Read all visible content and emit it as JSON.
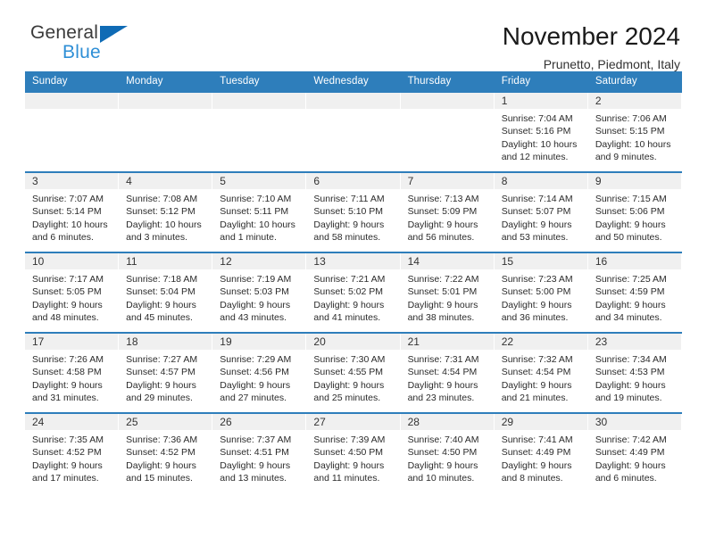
{
  "brand": {
    "line1": "General",
    "line2": "Blue",
    "triangle_color": "#0f6bb5",
    "blue_text_color": "#2f8fd6"
  },
  "header": {
    "title": "November 2024",
    "subtitle": "Prunetto, Piedmont, Italy",
    "accent_color": "#2e7ebb",
    "daynum_strip_color": "#f0f0f0"
  },
  "weekdays": [
    "Sunday",
    "Monday",
    "Tuesday",
    "Wednesday",
    "Thursday",
    "Friday",
    "Saturday"
  ],
  "weeks": [
    [
      {
        "day": "",
        "empty": true
      },
      {
        "day": "",
        "empty": true
      },
      {
        "day": "",
        "empty": true
      },
      {
        "day": "",
        "empty": true
      },
      {
        "day": "",
        "empty": true
      },
      {
        "day": "1",
        "sunrise": "Sunrise: 7:04 AM",
        "sunset": "Sunset: 5:16 PM",
        "daylight1": "Daylight: 10 hours",
        "daylight2": "and 12 minutes."
      },
      {
        "day": "2",
        "sunrise": "Sunrise: 7:06 AM",
        "sunset": "Sunset: 5:15 PM",
        "daylight1": "Daylight: 10 hours",
        "daylight2": "and 9 minutes."
      }
    ],
    [
      {
        "day": "3",
        "sunrise": "Sunrise: 7:07 AM",
        "sunset": "Sunset: 5:14 PM",
        "daylight1": "Daylight: 10 hours",
        "daylight2": "and 6 minutes."
      },
      {
        "day": "4",
        "sunrise": "Sunrise: 7:08 AM",
        "sunset": "Sunset: 5:12 PM",
        "daylight1": "Daylight: 10 hours",
        "daylight2": "and 3 minutes."
      },
      {
        "day": "5",
        "sunrise": "Sunrise: 7:10 AM",
        "sunset": "Sunset: 5:11 PM",
        "daylight1": "Daylight: 10 hours",
        "daylight2": "and 1 minute."
      },
      {
        "day": "6",
        "sunrise": "Sunrise: 7:11 AM",
        "sunset": "Sunset: 5:10 PM",
        "daylight1": "Daylight: 9 hours",
        "daylight2": "and 58 minutes."
      },
      {
        "day": "7",
        "sunrise": "Sunrise: 7:13 AM",
        "sunset": "Sunset: 5:09 PM",
        "daylight1": "Daylight: 9 hours",
        "daylight2": "and 56 minutes."
      },
      {
        "day": "8",
        "sunrise": "Sunrise: 7:14 AM",
        "sunset": "Sunset: 5:07 PM",
        "daylight1": "Daylight: 9 hours",
        "daylight2": "and 53 minutes."
      },
      {
        "day": "9",
        "sunrise": "Sunrise: 7:15 AM",
        "sunset": "Sunset: 5:06 PM",
        "daylight1": "Daylight: 9 hours",
        "daylight2": "and 50 minutes."
      }
    ],
    [
      {
        "day": "10",
        "sunrise": "Sunrise: 7:17 AM",
        "sunset": "Sunset: 5:05 PM",
        "daylight1": "Daylight: 9 hours",
        "daylight2": "and 48 minutes."
      },
      {
        "day": "11",
        "sunrise": "Sunrise: 7:18 AM",
        "sunset": "Sunset: 5:04 PM",
        "daylight1": "Daylight: 9 hours",
        "daylight2": "and 45 minutes."
      },
      {
        "day": "12",
        "sunrise": "Sunrise: 7:19 AM",
        "sunset": "Sunset: 5:03 PM",
        "daylight1": "Daylight: 9 hours",
        "daylight2": "and 43 minutes."
      },
      {
        "day": "13",
        "sunrise": "Sunrise: 7:21 AM",
        "sunset": "Sunset: 5:02 PM",
        "daylight1": "Daylight: 9 hours",
        "daylight2": "and 41 minutes."
      },
      {
        "day": "14",
        "sunrise": "Sunrise: 7:22 AM",
        "sunset": "Sunset: 5:01 PM",
        "daylight1": "Daylight: 9 hours",
        "daylight2": "and 38 minutes."
      },
      {
        "day": "15",
        "sunrise": "Sunrise: 7:23 AM",
        "sunset": "Sunset: 5:00 PM",
        "daylight1": "Daylight: 9 hours",
        "daylight2": "and 36 minutes."
      },
      {
        "day": "16",
        "sunrise": "Sunrise: 7:25 AM",
        "sunset": "Sunset: 4:59 PM",
        "daylight1": "Daylight: 9 hours",
        "daylight2": "and 34 minutes."
      }
    ],
    [
      {
        "day": "17",
        "sunrise": "Sunrise: 7:26 AM",
        "sunset": "Sunset: 4:58 PM",
        "daylight1": "Daylight: 9 hours",
        "daylight2": "and 31 minutes."
      },
      {
        "day": "18",
        "sunrise": "Sunrise: 7:27 AM",
        "sunset": "Sunset: 4:57 PM",
        "daylight1": "Daylight: 9 hours",
        "daylight2": "and 29 minutes."
      },
      {
        "day": "19",
        "sunrise": "Sunrise: 7:29 AM",
        "sunset": "Sunset: 4:56 PM",
        "daylight1": "Daylight: 9 hours",
        "daylight2": "and 27 minutes."
      },
      {
        "day": "20",
        "sunrise": "Sunrise: 7:30 AM",
        "sunset": "Sunset: 4:55 PM",
        "daylight1": "Daylight: 9 hours",
        "daylight2": "and 25 minutes."
      },
      {
        "day": "21",
        "sunrise": "Sunrise: 7:31 AM",
        "sunset": "Sunset: 4:54 PM",
        "daylight1": "Daylight: 9 hours",
        "daylight2": "and 23 minutes."
      },
      {
        "day": "22",
        "sunrise": "Sunrise: 7:32 AM",
        "sunset": "Sunset: 4:54 PM",
        "daylight1": "Daylight: 9 hours",
        "daylight2": "and 21 minutes."
      },
      {
        "day": "23",
        "sunrise": "Sunrise: 7:34 AM",
        "sunset": "Sunset: 4:53 PM",
        "daylight1": "Daylight: 9 hours",
        "daylight2": "and 19 minutes."
      }
    ],
    [
      {
        "day": "24",
        "sunrise": "Sunrise: 7:35 AM",
        "sunset": "Sunset: 4:52 PM",
        "daylight1": "Daylight: 9 hours",
        "daylight2": "and 17 minutes."
      },
      {
        "day": "25",
        "sunrise": "Sunrise: 7:36 AM",
        "sunset": "Sunset: 4:52 PM",
        "daylight1": "Daylight: 9 hours",
        "daylight2": "and 15 minutes."
      },
      {
        "day": "26",
        "sunrise": "Sunrise: 7:37 AM",
        "sunset": "Sunset: 4:51 PM",
        "daylight1": "Daylight: 9 hours",
        "daylight2": "and 13 minutes."
      },
      {
        "day": "27",
        "sunrise": "Sunrise: 7:39 AM",
        "sunset": "Sunset: 4:50 PM",
        "daylight1": "Daylight: 9 hours",
        "daylight2": "and 11 minutes."
      },
      {
        "day": "28",
        "sunrise": "Sunrise: 7:40 AM",
        "sunset": "Sunset: 4:50 PM",
        "daylight1": "Daylight: 9 hours",
        "daylight2": "and 10 minutes."
      },
      {
        "day": "29",
        "sunrise": "Sunrise: 7:41 AM",
        "sunset": "Sunset: 4:49 PM",
        "daylight1": "Daylight: 9 hours",
        "daylight2": "and 8 minutes."
      },
      {
        "day": "30",
        "sunrise": "Sunrise: 7:42 AM",
        "sunset": "Sunset: 4:49 PM",
        "daylight1": "Daylight: 9 hours",
        "daylight2": "and 6 minutes."
      }
    ]
  ]
}
